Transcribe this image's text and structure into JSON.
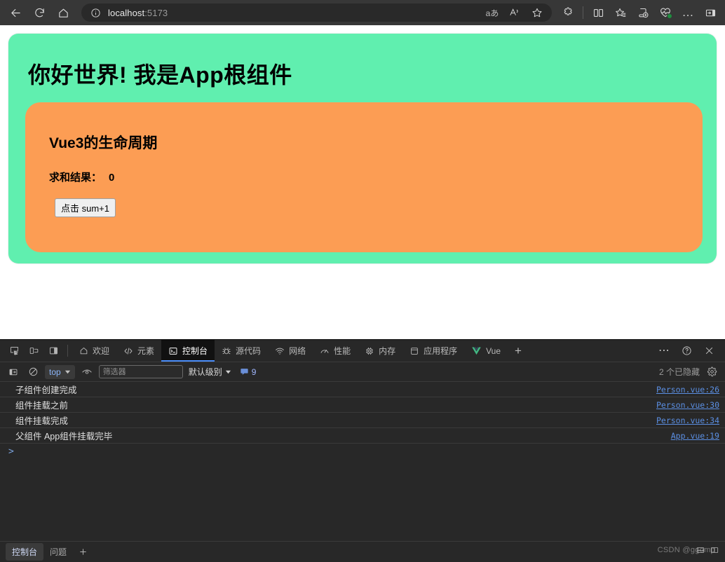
{
  "browser": {
    "back_tooltip": "后退",
    "refresh_tooltip": "刷新",
    "home_tooltip": "主页",
    "url_host": "localhost",
    "url_port": ":5173",
    "icons": {
      "read_aloud": "aあ",
      "translate": "A-pronounce-icon",
      "favorite": "star-icon",
      "extensions": "puzzle-icon",
      "split_screen": "split-screen-icon",
      "collections": "collections-icon",
      "add_tab": "add-to-collection-icon",
      "performance": "heartbeat-icon",
      "more": "…",
      "sidebar": "sidebar-icon"
    }
  },
  "page": {
    "app_title": "你好世界! 我是App根组件",
    "card_title": "Vue3的生命周期",
    "sum_label": "求和结果：",
    "sum_value": "0",
    "button_label": "点击 sum+1",
    "colors": {
      "app_bg": "#60efaf",
      "card_bg": "#fc9d54"
    }
  },
  "devtools": {
    "tabs": [
      {
        "label": "欢迎",
        "icon": "home-icon",
        "active": false
      },
      {
        "label": "元素",
        "icon": "code-brackets-icon",
        "active": false
      },
      {
        "label": "控制台",
        "icon": "console-terminal-icon",
        "active": true
      },
      {
        "label": "源代码",
        "icon": "bug-icon",
        "active": false
      },
      {
        "label": "网络",
        "icon": "wifi-icon",
        "active": false
      },
      {
        "label": "性能",
        "icon": "speedometer-icon",
        "active": false
      },
      {
        "label": "内存",
        "icon": "memory-chip-icon",
        "active": false
      },
      {
        "label": "应用程序",
        "icon": "database-icon",
        "active": false
      },
      {
        "label": "Vue",
        "icon": "vue-logo-icon",
        "active": false
      }
    ],
    "add_tab_label": "+",
    "more_label": "⋯",
    "help_label": "?",
    "close_label": "✕",
    "console_toolbar": {
      "sidebar_toggle": "console-sidebar-icon",
      "clear_label": "clear-console-icon",
      "context": "top",
      "eye_label": "live-expression-icon",
      "filter_placeholder": "筛选器",
      "filter_value": "",
      "level_label": "默认级别",
      "issues_count": "9",
      "hidden_label": "2 个已隐藏",
      "settings_label": "gear-icon"
    },
    "messages": [
      {
        "text": "子组件创建完成",
        "source": "Person.vue:26"
      },
      {
        "text": "组件挂载之前",
        "source": "Person.vue:30"
      },
      {
        "text": "组件挂载完成",
        "source": "Person.vue:34"
      },
      {
        "text": "父组件  App组件挂载完毕",
        "source": "App.vue:19"
      }
    ],
    "prompt": ">",
    "drawer": {
      "tabs": [
        {
          "label": "控制台",
          "active": true
        },
        {
          "label": "问题",
          "active": false
        }
      ],
      "add_label": "+"
    },
    "watermark": "CSDN @ggomp"
  }
}
